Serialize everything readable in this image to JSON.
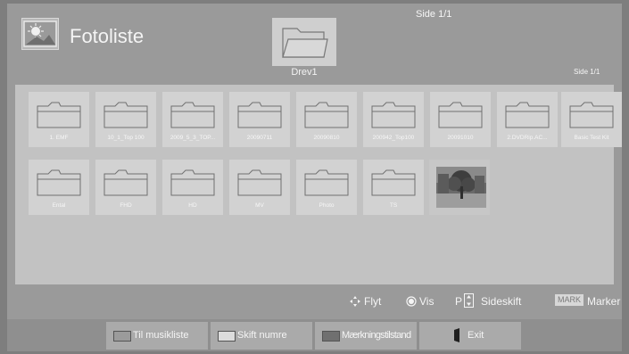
{
  "header": {
    "title": "Fotoliste",
    "top_page": "Side 1/1",
    "drive_label": "Drev1",
    "page_indicator": "Side 1/1"
  },
  "items": [
    {
      "label": "1. EMF"
    },
    {
      "label": "10_1_Top 100"
    },
    {
      "label": "2009_5_3_TOP..."
    },
    {
      "label": "20090711"
    },
    {
      "label": "20090810"
    },
    {
      "label": "200942_Top100"
    },
    {
      "label": "20091010"
    },
    {
      "label": "2.DVDRip.AC..."
    },
    {
      "label": "Basic Test Kit"
    },
    {
      "label": "Ental"
    },
    {
      "label": "FHD"
    },
    {
      "label": "HD"
    },
    {
      "label": "MV"
    },
    {
      "label": "Photo"
    },
    {
      "label": "TS"
    }
  ],
  "hints": {
    "move": "Flyt",
    "view": "Vis",
    "page_prefix": "P",
    "page_switch": "Sideskift",
    "mark_key": "MARK",
    "mark": "Marker"
  },
  "buttons": {
    "music": "Til musikliste",
    "sort": "Skift numre",
    "mark_state": "Mærkningstilstand",
    "exit": "Exit"
  },
  "colors": {
    "background": "#7e7e7e",
    "panel": "#9a9a9a",
    "grid": "#c2c2c2",
    "tile": "#d2d2d2",
    "button": "#aaaaaa",
    "text": "#f5f5f5"
  }
}
